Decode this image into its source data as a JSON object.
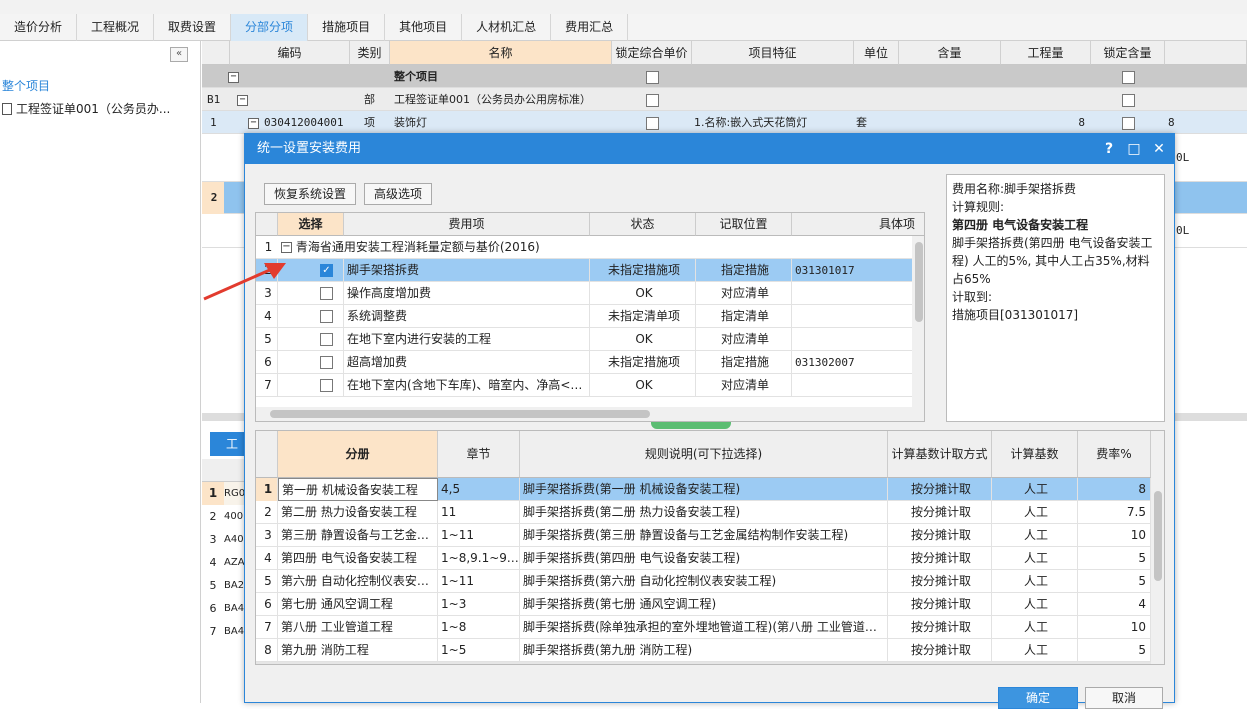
{
  "tabs": [
    "造价分析",
    "工程概况",
    "取费设置",
    "分部分项",
    "措施项目",
    "其他项目",
    "人材机汇总",
    "费用汇总"
  ],
  "active_tab_index": 3,
  "sidebar": {
    "collapse": "«",
    "title": "整个项目",
    "item": "工程签证单001（公务员办..."
  },
  "grid": {
    "headers": [
      "编码",
      "类别",
      "名称",
      "锁定综合单价",
      "项目特征",
      "单位",
      "含量",
      "工程量",
      "锁定含量"
    ],
    "row0": {
      "name": "整个项目"
    },
    "row1": {
      "idx": "B1",
      "type": "部",
      "name": "工程签证单001（公务员办公用房标准）"
    },
    "row2": {
      "idx": "1",
      "code": "030412004001",
      "type": "项",
      "name": "装饰灯",
      "feature": "1.名称:嵌入式天花筒灯",
      "unit": "套",
      "qty": "8",
      "extra": "8"
    },
    "row3": {
      "idx": "2"
    },
    "edge_text": [
      "0L",
      "0L"
    ]
  },
  "lower_left": {
    "tab": "工",
    "rows": [
      "RG0",
      "400",
      "A40",
      "AZA",
      "BA2",
      "BA4",
      "BA4"
    ]
  },
  "dialog": {
    "title": "统一设置安装费用",
    "help": "?",
    "maximize": "□",
    "close": "✕",
    "restore_btn": "恢复系统设置",
    "advanced_btn": "高级选项",
    "upper_headers": [
      "选择",
      "费用项",
      "状态",
      "记取位置",
      "具体项"
    ],
    "group_row": "青海省通用安装工程消耗量定额与基价(2016)",
    "upper_rows": [
      {
        "n": "2",
        "checked": true,
        "name": "脚手架搭拆费",
        "status": "未指定措施项",
        "pos": "指定措施",
        "item": "031301017"
      },
      {
        "n": "3",
        "checked": false,
        "name": "操作高度增加费",
        "status": "OK",
        "pos": "对应清单",
        "item": ""
      },
      {
        "n": "4",
        "checked": false,
        "name": "系统调整费",
        "status": "未指定清单项",
        "pos": "指定清单",
        "item": ""
      },
      {
        "n": "5",
        "checked": false,
        "name": "在地下室内进行安装的工程",
        "status": "OK",
        "pos": "对应清单",
        "item": ""
      },
      {
        "n": "6",
        "checked": false,
        "name": "超高增加费",
        "status": "未指定措施项",
        "pos": "指定措施",
        "item": "031302007"
      },
      {
        "n": "7",
        "checked": false,
        "name": "在地下室内(含地下车库)、暗室内、净高<…",
        "status": "OK",
        "pos": "对应清单",
        "item": ""
      }
    ],
    "info": {
      "l1": "费用名称:脚手架搭拆费",
      "l2": "计算规则:",
      "l3": "第四册 电气设备安装工程",
      "l4": "脚手架搭拆费(第四册 电气设备安装工程) 人工的5%, 其中人工占35%,材料占65%",
      "l5": "计取到:",
      "l6": "措施项目[031301017]"
    },
    "lower_headers": [
      "分册",
      "章节",
      "规则说明(可下拉选择)",
      "计算基数计取方式",
      "计算基数",
      "费率%"
    ],
    "lower_rows": [
      {
        "n": "1",
        "book": "第一册 机械设备安装工程",
        "chap": "4,5",
        "rule": "脚手架搭拆费(第一册 机械设备安装工程)",
        "mode": "按分摊计取",
        "base": "人工",
        "rate": "8"
      },
      {
        "n": "2",
        "book": "第二册 热力设备安装工程",
        "chap": "11",
        "rule": "脚手架搭拆费(第二册 热力设备安装工程)",
        "mode": "按分摊计取",
        "base": "人工",
        "rate": "7.5"
      },
      {
        "n": "3",
        "book": "第三册 静置设备与工艺金…",
        "chap": "1~11",
        "rule": "脚手架搭拆费(第三册 静置设备与工艺金属结构制作安装工程)",
        "mode": "按分摊计取",
        "base": "人工",
        "rate": "10"
      },
      {
        "n": "4",
        "book": "第四册 电气设备安装工程",
        "chap": "1~8,9.1~9.…",
        "rule": "脚手架搭拆费(第四册 电气设备安装工程)",
        "mode": "按分摊计取",
        "base": "人工",
        "rate": "5"
      },
      {
        "n": "5",
        "book": "第六册 自动化控制仪表安…",
        "chap": "1~11",
        "rule": "脚手架搭拆费(第六册 自动化控制仪表安装工程)",
        "mode": "按分摊计取",
        "base": "人工",
        "rate": "5"
      },
      {
        "n": "6",
        "book": "第七册 通风空调工程",
        "chap": "1~3",
        "rule": "脚手架搭拆费(第七册 通风空调工程)",
        "mode": "按分摊计取",
        "base": "人工",
        "rate": "4"
      },
      {
        "n": "7",
        "book": "第八册 工业管道工程",
        "chap": "1~8",
        "rule": "脚手架搭拆费(除单独承担的室外埋地管道工程)(第八册 工业管道…",
        "mode": "按分摊计取",
        "base": "人工",
        "rate": "10"
      },
      {
        "n": "8",
        "book": "第九册 消防工程",
        "chap": "1~5",
        "rule": "脚手架搭拆费(第九册 消防工程)",
        "mode": "按分摊计取",
        "base": "人工",
        "rate": "5"
      }
    ],
    "ok_btn": "确定",
    "cancel_btn": "取消"
  }
}
